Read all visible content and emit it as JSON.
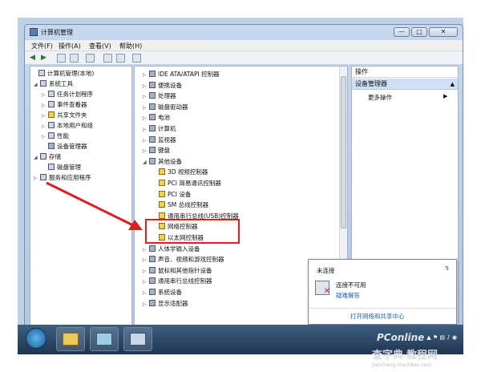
{
  "window": {
    "title": "计算机管理",
    "buttons": {
      "minimize": "—",
      "maximize": "□",
      "close": "✕"
    }
  },
  "menu": [
    "文件(F)",
    "操作(A)",
    "查看(V)",
    "帮助(H)"
  ],
  "left_tree": [
    {
      "label": "计算机管理(本地)",
      "level": 0,
      "expander": ""
    },
    {
      "label": "系统工具",
      "level": 1,
      "expander": "◢"
    },
    {
      "label": "任务计划程序",
      "level": 2,
      "expander": "▷"
    },
    {
      "label": "事件查看器",
      "level": 2,
      "expander": "▷"
    },
    {
      "label": "共享文件夹",
      "level": 2,
      "expander": "▷"
    },
    {
      "label": "本地用户和组",
      "level": 2,
      "expander": "▷"
    },
    {
      "label": "性能",
      "level": 2,
      "expander": "▷"
    },
    {
      "label": "设备管理器",
      "level": 2,
      "expander": ""
    },
    {
      "label": "存储",
      "level": 1,
      "expander": "◢"
    },
    {
      "label": "磁盘管理",
      "level": 2,
      "expander": ""
    },
    {
      "label": "服务和应用程序",
      "level": 1,
      "expander": "▷"
    }
  ],
  "device_tree": [
    {
      "label": "IDE ATA/ATAPI 控制器",
      "level": 0,
      "warn": false
    },
    {
      "label": "便携设备",
      "level": 0,
      "warn": false
    },
    {
      "label": "处理器",
      "level": 0,
      "warn": false
    },
    {
      "label": "磁盘驱动器",
      "level": 0,
      "warn": false
    },
    {
      "label": "电池",
      "level": 0,
      "warn": false
    },
    {
      "label": "计算机",
      "level": 0,
      "warn": false
    },
    {
      "label": "监视器",
      "level": 0,
      "warn": false
    },
    {
      "label": "键盘",
      "level": 0,
      "warn": false
    },
    {
      "label": "其他设备",
      "level": 0,
      "warn": false
    },
    {
      "label": "3D 视频控制器",
      "level": 1,
      "warn": true
    },
    {
      "label": "PCI 简易通讯控制器",
      "level": 1,
      "warn": true
    },
    {
      "label": "PCI 设备",
      "level": 1,
      "warn": true
    },
    {
      "label": "SM 总线控制器",
      "level": 1,
      "warn": true
    },
    {
      "label": "通用串行总线(USB)控制器",
      "level": 1,
      "warn": true
    },
    {
      "label": "网络控制器",
      "level": 1,
      "warn": true
    },
    {
      "label": "以太网控制器",
      "level": 1,
      "warn": true
    },
    {
      "label": "人体学输入设备",
      "level": 0,
      "warn": false
    },
    {
      "label": "声音、视频和游戏控制器",
      "level": 0,
      "warn": false
    },
    {
      "label": "鼠标和其他指针设备",
      "level": 0,
      "warn": false
    },
    {
      "label": "通用串行总线控制器",
      "level": 0,
      "warn": false
    },
    {
      "label": "系统设备",
      "level": 0,
      "warn": false
    },
    {
      "label": "显示适配器",
      "level": 0,
      "warn": false
    }
  ],
  "actions": {
    "header": "操作",
    "selected": "设备管理器",
    "more": "更多操作"
  },
  "network_popup": {
    "heading": "未连接",
    "status": "连接不可用",
    "troubleshoot": "疑难解答",
    "open_center": "打开网络和共享中心"
  },
  "watermarks": {
    "brand": "PConline",
    "site": "查字典",
    "site_suffix": "教程网",
    "url": "jiaocheng.chazidian.com"
  },
  "colors": {
    "highlight_box": "#e21b1b",
    "warning": "#f2d248"
  }
}
